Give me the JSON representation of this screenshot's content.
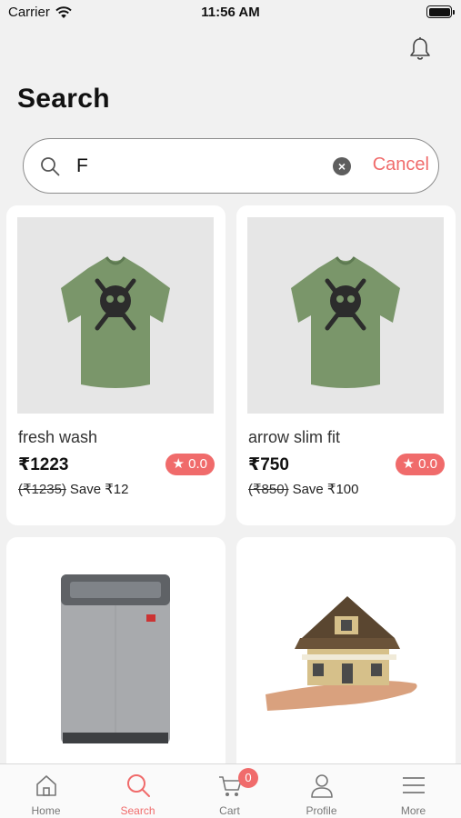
{
  "status_bar": {
    "carrier": "Carrier",
    "time": "11:56 AM"
  },
  "header": {
    "title": "Search",
    "notification_icon": "bell-icon"
  },
  "search": {
    "value": "F",
    "placeholder": "",
    "cancel_label": "Cancel"
  },
  "products": [
    {
      "name": "fresh wash",
      "price": "₹1223",
      "old_price": "(₹1235)",
      "save": "Save ₹12",
      "rating": "★ 0.0",
      "image": "green-tshirt"
    },
    {
      "name": "arrow slim fit",
      "price": "₹750",
      "old_price": "(₹850)",
      "save": "Save ₹100",
      "rating": "★ 0.0",
      "image": "green-tshirt"
    },
    {
      "image": "washing-machine"
    },
    {
      "image": "house-in-hand"
    }
  ],
  "tab_bar": {
    "items": [
      {
        "label": "Home",
        "icon": "home-icon"
      },
      {
        "label": "Search",
        "icon": "search-icon",
        "active": true
      },
      {
        "label": "Cart",
        "icon": "cart-icon",
        "badge": "0"
      },
      {
        "label": "Profile",
        "icon": "profile-icon"
      },
      {
        "label": "More",
        "icon": "menu-icon"
      }
    ]
  },
  "colors": {
    "accent": "#f06b6b",
    "background": "#f1f1f1",
    "card": "#ffffff"
  }
}
